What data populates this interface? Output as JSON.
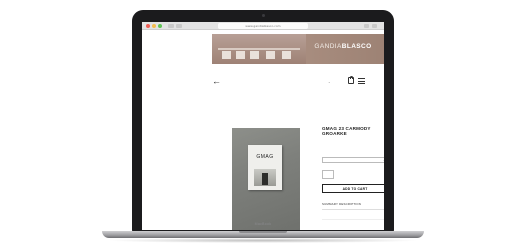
{
  "device": {
    "label": "MacBook"
  },
  "browser": {
    "url": "www.gandiablasco.com"
  },
  "banner": {
    "brand_light": "GANDIA",
    "brand_bold": "BLASCO",
    "tagline": "",
    "badge": "",
    "number": ""
  },
  "header": {
    "back_icon": "arrow-left-icon",
    "account_label": "",
    "bag_icon": "bag-icon",
    "menu_icon": "hamburger-menu-icon"
  },
  "product": {
    "image_title": "GMAG",
    "title": "GMAG 23 CARMODY GROARKE",
    "price": "",
    "tax_note": "",
    "option_label": "",
    "option_value": "",
    "qty_label": "",
    "qty_value": "",
    "add_to_cart_label": "ADD TO CART",
    "summary_label": "SUMMARY DESCRIPTION",
    "summary_toggle": "+"
  },
  "colors": {
    "banner": "#a98e80",
    "laptop": "#1b1b1d"
  }
}
